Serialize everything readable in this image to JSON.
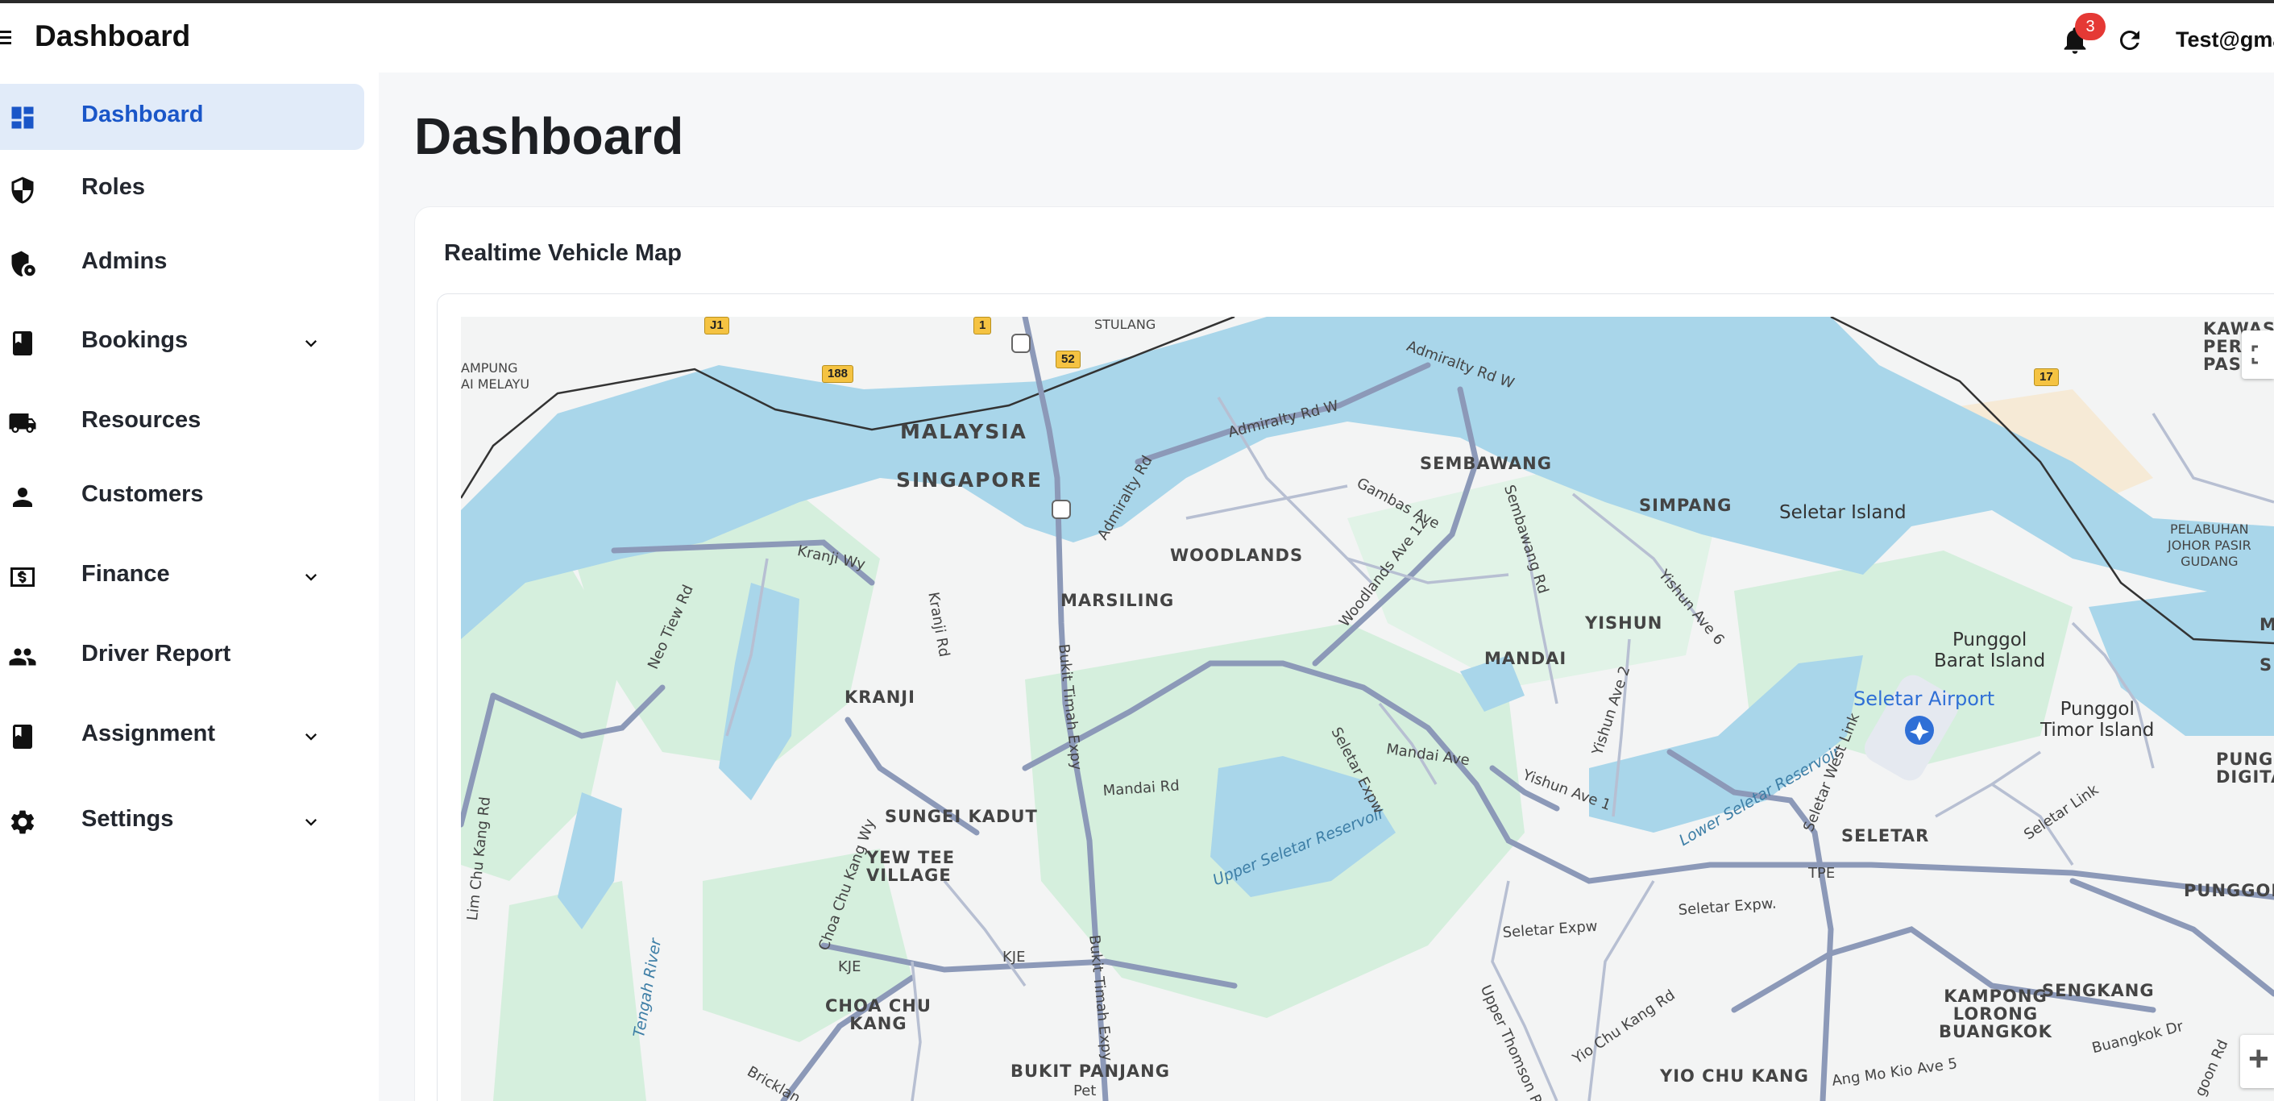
{
  "topbar": {
    "title": "Dashboard",
    "notifications_count": "3",
    "user_email": "Test@gma"
  },
  "sidebar": {
    "items": [
      {
        "label": "Dashboard",
        "icon": "dashboard-icon",
        "active": true,
        "has_submenu": false
      },
      {
        "label": "Roles",
        "icon": "shield-icon",
        "active": false,
        "has_submenu": false
      },
      {
        "label": "Admins",
        "icon": "admin-shield-icon",
        "active": false,
        "has_submenu": false
      },
      {
        "label": "Bookings",
        "icon": "book-icon",
        "active": false,
        "has_submenu": true
      },
      {
        "label": "Resources",
        "icon": "truck-icon",
        "active": false,
        "has_submenu": false
      },
      {
        "label": "Customers",
        "icon": "person-icon",
        "active": false,
        "has_submenu": false
      },
      {
        "label": "Finance",
        "icon": "money-icon",
        "active": false,
        "has_submenu": true
      },
      {
        "label": "Driver Report",
        "icon": "people-icon",
        "active": false,
        "has_submenu": false
      },
      {
        "label": "Assignment",
        "icon": "book-icon",
        "active": false,
        "has_submenu": true
      },
      {
        "label": "Settings",
        "icon": "gear-icon",
        "active": false,
        "has_submenu": true
      }
    ]
  },
  "main": {
    "title": "Dashboard",
    "card_title": "Realtime Vehicle Map"
  },
  "map": {
    "labels": {
      "malaysia": "MALAYSIA",
      "singapore": "SINGAPORE",
      "sembawang": "SEMBAWANG",
      "simpang": "SIMPANG",
      "seletar_island": "Seletar Island",
      "woodlands": "WOODLANDS",
      "marsiling": "MARSILING",
      "yishun": "YISHUN",
      "mandai": "MANDAI",
      "kranji": "KRANJI",
      "sungei_kadut": "SUNGEI KADUT",
      "yew_tee": "YEW TEE\nVILLAGE",
      "choa_chu_kang": "CHOA CHU\nKANG",
      "bukit_panjang": "BUKIT PANJANG",
      "yio_chu_kang": "YIO CHU KANG",
      "seletar": "SELETAR",
      "punggol": "PUNGGOL",
      "sengkang": "SENGKANG",
      "kampong_lorong_buangkok": "KAMPONG\nLORONG\nBUANGKOK",
      "punggol_barat_island": "Punggol\nBarat Island",
      "punggol_timor_island": "Punggol\nTimor Island",
      "seletar_airport": "Seletar Airport",
      "pelabuhan": "PELABUHAN\nJOHOR PASIR\nGUDANG",
      "kawasan": "KAWASA\nPERINDU\nPASIR G",
      "kampung": "AMPUNG\nAI MELAYU",
      "stulang": "STULANG",
      "upper_seletar_reservoir": "Upper Seletar Reservoir",
      "lower_seletar_reservoir": "Lower Seletar Reservoir",
      "punggol_digital": "PUNGG\nDIGITAL D",
      "tengah_river": "Tengah River",
      "admiralty_rd_w": "Admiralty Rd W",
      "admiralty_rd": "Admiralty Rd",
      "gambas_ave": "Gambas Ave",
      "woodlands_ave12": "Woodlands Ave 12",
      "sembawang_rd": "Sembawang Rd",
      "yishun_ave6": "Yishun Ave 6",
      "yishun_ave2": "Yishun Ave 2",
      "yishun_ave1": "Yishun Ave 1",
      "kranji_wy": "Kranji Wy",
      "kranji_rd": "Kranji Rd",
      "neo_tiew_rd": "Neo Tiew Rd",
      "bukit_timah_expy": "Bukit Timah Expy",
      "mandai_rd": "Mandai Rd",
      "mandai_ave": "Mandai Ave",
      "seletar_expw": "Seletar Expw",
      "seletar_expw2": "Seletar Expw",
      "seletar_expw3": "Seletar Expw.",
      "seletar_west_link": "Seletar West Link",
      "seletar_link": "Seletar Link",
      "lim_chu_kang_rd": "Lim Chu Kang Rd",
      "choa_chu_kang_wy": "Choa Chu Kang Wy",
      "kje": "KJE",
      "kje2": "KJE",
      "tpe": "TPE",
      "upper_thomson_rd": "Upper Thomson Rd",
      "yio_chu_kang_rd": "Yio Chu Kang Rd",
      "ang_mo_kio_ave5": "Ang Mo Kio Ave 5",
      "buangkok_dr": "Buangkok Dr",
      "bukit_timah_expy2": "Bukit Timah Expy",
      "bricklands": "Bricklan",
      "simpang_s": "S",
      "m_edge": "M",
      "pet": "Pet",
      "goon_rd": "goon Rd"
    },
    "shields": {
      "j1": "J1",
      "r1": "1",
      "r52": "52",
      "r188": "188",
      "r17": "17"
    },
    "colors": {
      "water": "#a9d6ea",
      "land": "#f3f4f4",
      "green": "#d5efdd",
      "road": "#8c99b8",
      "border": "#333333"
    }
  },
  "colors": {
    "accent": "#1a56c8",
    "active_bg": "#e1ebf9",
    "badge": "#e53935"
  }
}
